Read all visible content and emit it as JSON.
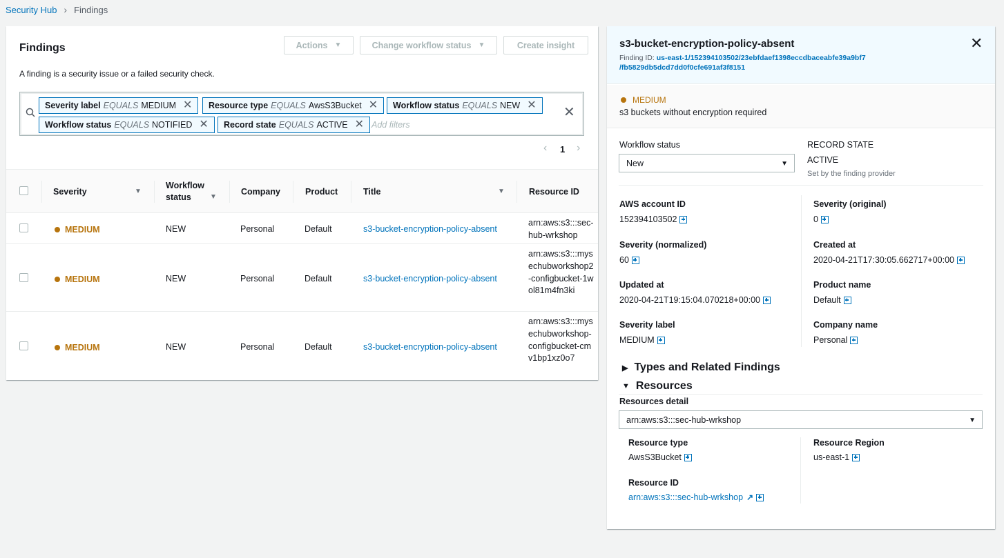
{
  "breadcrumb": {
    "root": "Security Hub",
    "current": "Findings"
  },
  "findings": {
    "title": "Findings",
    "description": "A finding is a security issue or a failed security check.",
    "buttons": {
      "actions": "Actions",
      "change_workflow": "Change workflow status",
      "create_insight": "Create insight"
    },
    "filters": [
      {
        "key": "Severity label",
        "op": "EQUALS",
        "value": "MEDIUM"
      },
      {
        "key": "Resource type",
        "op": "EQUALS",
        "value": "AwsS3Bucket"
      },
      {
        "key": "Workflow status",
        "op": "EQUALS",
        "value": "NEW"
      },
      {
        "key": "Workflow status",
        "op": "EQUALS",
        "value": "NOTIFIED"
      },
      {
        "key": "Record state",
        "op": "EQUALS",
        "value": "ACTIVE"
      }
    ],
    "add_filters_placeholder": "Add filters",
    "page": "1",
    "columns": {
      "severity": "Severity",
      "workflow_1": "Workflow",
      "workflow_2": "status",
      "company": "Company",
      "product": "Product",
      "title": "Title",
      "resource_id": "Resource ID"
    },
    "rows": [
      {
        "severity": "MEDIUM",
        "workflow": "NEW",
        "company": "Personal",
        "product": "Default",
        "title": "s3-bucket-encryption-policy-absent",
        "resource_id": "arn:aws:s3:::sec-hub-wrkshop"
      },
      {
        "severity": "MEDIUM",
        "workflow": "NEW",
        "company": "Personal",
        "product": "Default",
        "title": "s3-bucket-encryption-policy-absent",
        "resource_id": "arn:aws:s3:::mysechubworkshop2-configbucket-1wol81m4fn3ki"
      },
      {
        "severity": "MEDIUM",
        "workflow": "NEW",
        "company": "Personal",
        "product": "Default",
        "title": "s3-bucket-encryption-policy-absent",
        "resource_id": "arn:aws:s3:::mysechubworkshop-configbucket-cmv1bp1xz0o7"
      }
    ]
  },
  "detail": {
    "title": "s3-bucket-encryption-policy-absent",
    "finding_id_label": "Finding ID:",
    "finding_id_1": "us-east-1/152394103502/23ebfdaef1398eccdbaceabfe39a9bf7",
    "finding_id_2": "/fb5829db5dcd7dd0f0cfe691af3f8151",
    "severity": "MEDIUM",
    "severity_desc": "s3 buckets without encryption required",
    "workflow_status_label": "Workflow status",
    "workflow_status_value": "New",
    "record_state_label": "RECORD STATE",
    "record_state_value": "ACTIVE",
    "record_state_caption": "Set by the finding provider",
    "fields": {
      "aws_account_id": {
        "label": "AWS account ID",
        "value": "152394103502"
      },
      "severity_original": {
        "label": "Severity (original)",
        "value": "0"
      },
      "severity_normalized": {
        "label": "Severity (normalized)",
        "value": "60"
      },
      "created_at": {
        "label": "Created at",
        "value": "2020-04-21T17:30:05.662717+00:00"
      },
      "updated_at": {
        "label": "Updated at",
        "value": "2020-04-21T19:15:04.070218+00:00"
      },
      "product_name": {
        "label": "Product name",
        "value": "Default"
      },
      "severity_label": {
        "label": "Severity label",
        "value": "MEDIUM"
      },
      "company_name": {
        "label": "Company name",
        "value": "Personal"
      }
    },
    "types_section": "Types and Related Findings",
    "resources_section": "Resources",
    "resources_detail_label": "Resources detail",
    "resources_selected": "arn:aws:s3:::sec-hub-wrkshop",
    "resource_type": {
      "label": "Resource type",
      "value": "AwsS3Bucket"
    },
    "resource_region": {
      "label": "Resource Region",
      "value": "us-east-1"
    },
    "resource_id": {
      "label": "Resource ID",
      "value": "arn:aws:s3:::sec-hub-wrkshop"
    }
  },
  "colors": {
    "link": "#0073bb",
    "medium": "#b7740d",
    "header_bg": "#f1faff"
  }
}
